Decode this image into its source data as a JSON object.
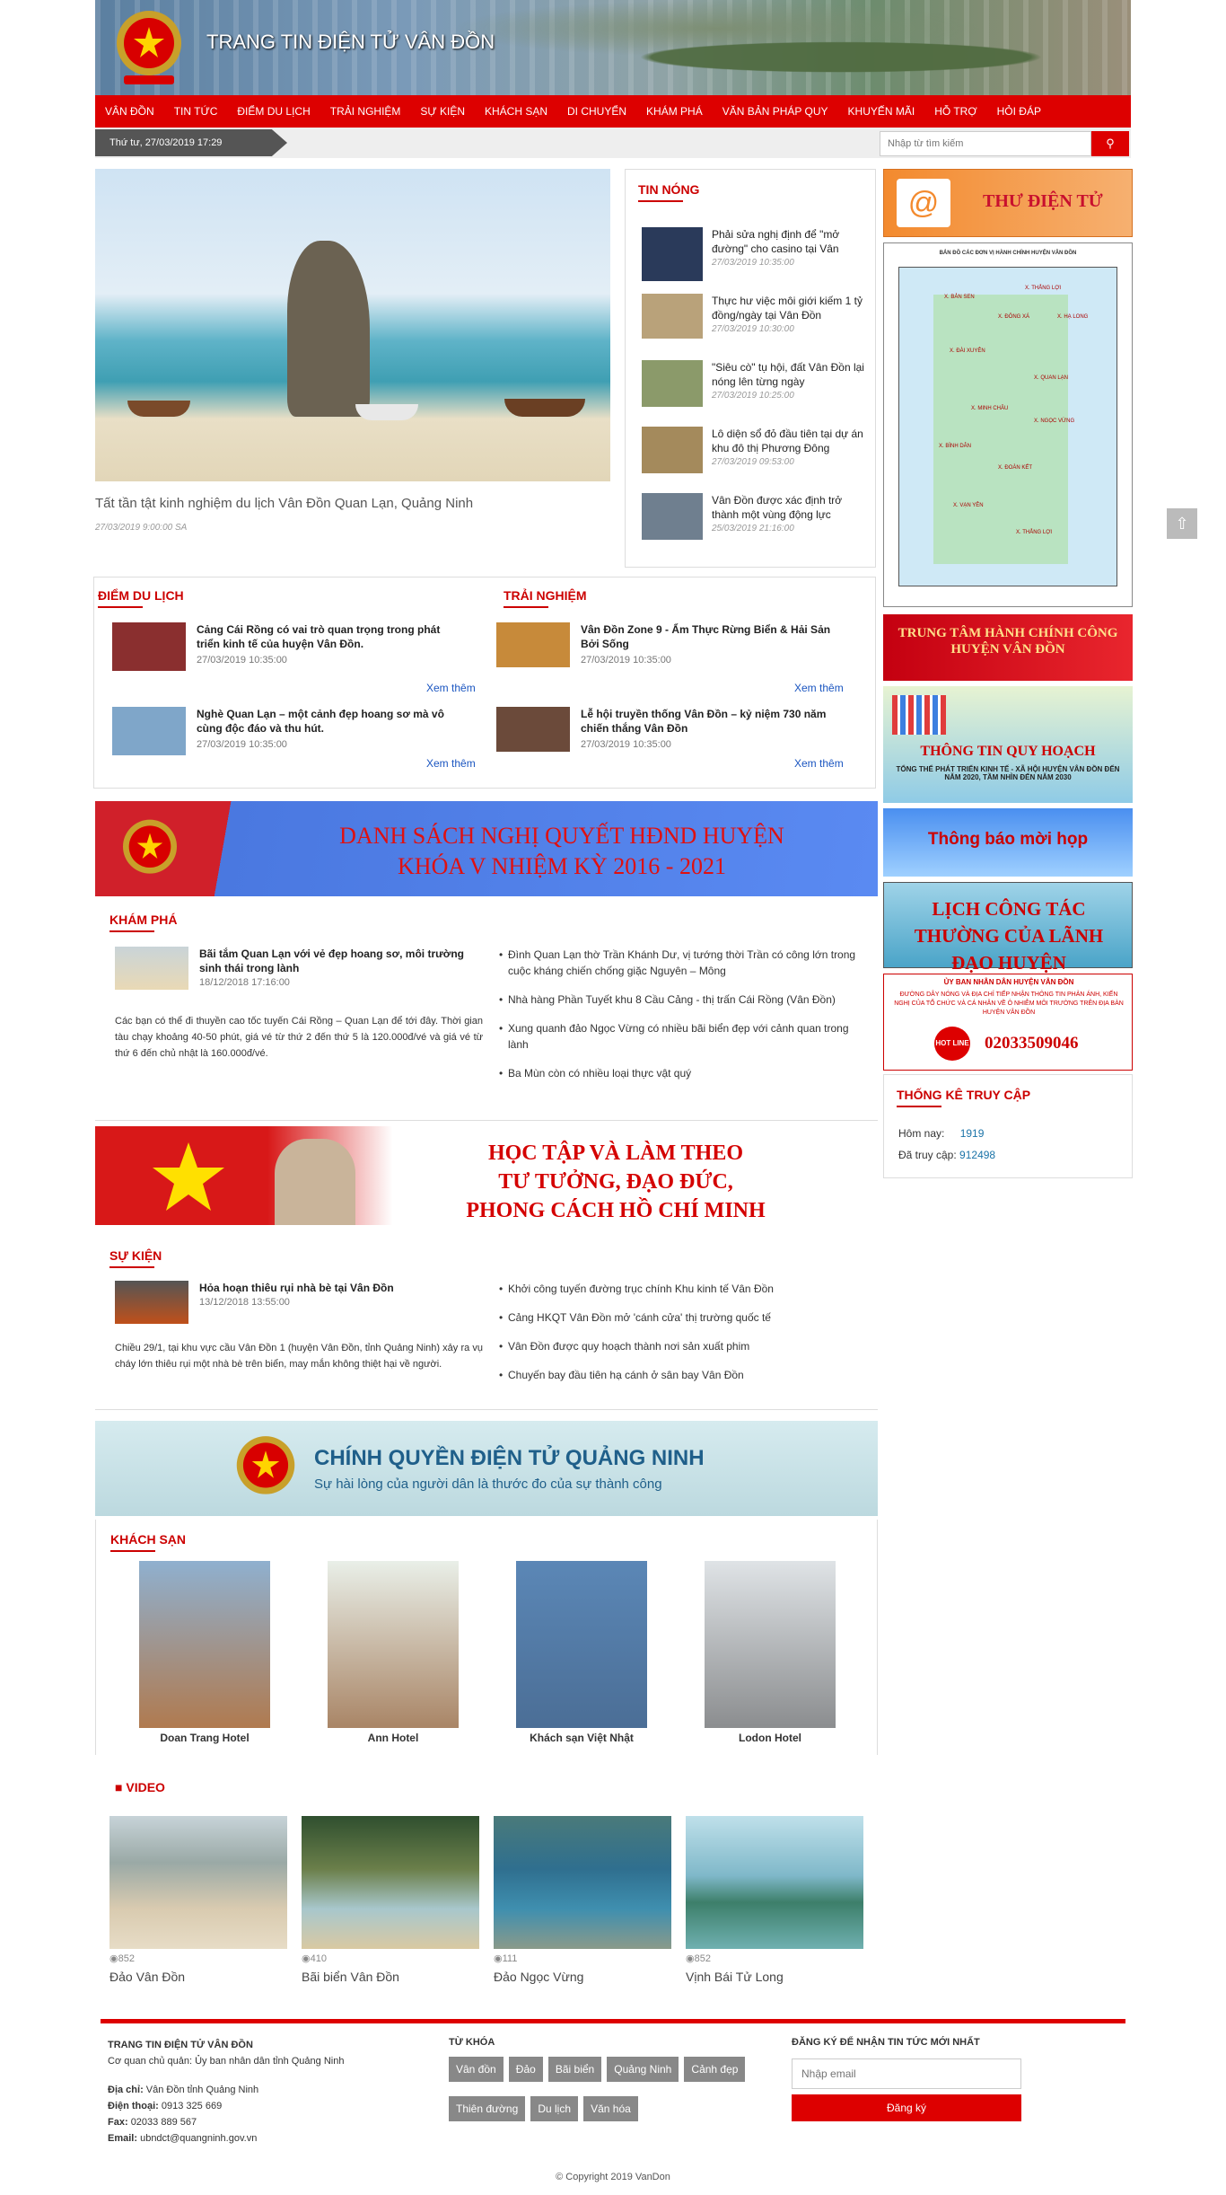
{
  "header": {
    "title": "TRANG TIN ĐIỆN TỬ VÂN ĐỒN"
  },
  "nav": [
    "VÂN ĐỒN",
    "TIN TỨC",
    "ĐIỂM DU LỊCH",
    "TRẢI NGHIỆM",
    "SỰ KIỆN",
    "KHÁCH SẠN",
    "DI CHUYỂN",
    "KHÁM PHÁ",
    "VĂN BẢN PHÁP QUY",
    "KHUYẾN MÃI",
    "HỖ TRỢ",
    "HỎI ĐÁP"
  ],
  "topbar": {
    "date": "Thứ tư, 27/03/2019 17:29",
    "search_placeholder": "Nhập từ tìm kiếm"
  },
  "featured": {
    "title": "Tất tần tật kinh nghiệm du lịch Vân Đồn Quan Lạn, Quảng Ninh",
    "date": "27/03/2019 9:00:00 SA"
  },
  "hot": {
    "title": "TIN NÓNG",
    "items": [
      {
        "title": "Phải sửa nghị định để \"mở đường\" cho casino tại Vân",
        "date": "27/03/2019 10:35:00"
      },
      {
        "title": "Thực hư việc môi giới kiếm 1 tỷ đồng/ngày tại Vân Đồn",
        "date": "27/03/2019 10:30:00"
      },
      {
        "title": "\"Siêu cò\" tụ hội, đất Vân Đồn lại nóng lên từng ngày",
        "date": "27/03/2019 10:25:00"
      },
      {
        "title": "Lô diện sổ đỏ đầu tiên tại dự án khu đô thị Phương Đông",
        "date": "27/03/2019 09:53:00"
      },
      {
        "title": "Vân Đồn được xác định trở thành một vùng động lực",
        "date": "25/03/2019 21:16:00"
      }
    ]
  },
  "dulich": {
    "title": "ĐIỂM DU LỊCH",
    "more": "Xem thêm",
    "items": [
      {
        "title": "Cảng Cái Rồng có vai trò quan trọng trong phát triển kinh tế của huyện Vân Đồn.",
        "date": "27/03/2019 10:35:00"
      },
      {
        "title": "Nghè Quan Lạn – một cảnh đẹp hoang sơ mà vô cùng độc đáo và thu hút.",
        "date": "27/03/2019 10:35:00"
      }
    ]
  },
  "trainghiem": {
    "title": "TRẢI NGHIỆM",
    "more": "Xem thêm",
    "items": [
      {
        "title": "Vân Đồn Zone 9 - Ẩm Thực Rừng Biển & Hải Sản Bởi Sống",
        "date": "27/03/2019 10:35:00"
      },
      {
        "title": "Lễ hội truyền thống Vân Đồn – kỷ niệm 730 năm chiến thắng Vân Đồn",
        "date": "27/03/2019 10:35:00"
      }
    ]
  },
  "banner1": {
    "line1": "DANH SÁCH NGHỊ QUYẾT HĐND HUYỆN",
    "line2": "KHÓA V NHIỆM KỲ 2016 - 2021"
  },
  "khampha": {
    "title": "KHÁM PHÁ",
    "lead_title": "Bãi tắm Quan Lạn với vẻ đẹp hoang sơ, môi trường sinh thái trong lành",
    "lead_date": "18/12/2018 17:16:00",
    "lead_desc": "Các bạn có thể đi thuyền cao tốc tuyến Cái Rồng – Quan Lạn để tới đây. Thời gian tàu chạy khoảng 40-50 phút, giá vé từ thứ 2 đến thứ 5 là 120.000đ/vé và giá vé từ thứ 6 đến chủ nhật là 160.000đ/vé.",
    "list": [
      "Đình Quan Lạn thờ Trần Khánh Dư, vị tướng thời Trần có công lớn trong cuộc kháng chiến chống giặc Nguyên – Mông",
      "Nhà hàng Phần Tuyết khu 8 Cầu Cảng - thị trấn Cái Rồng (Vân Đồn)",
      "Xung quanh đảo Ngọc Vừng có nhiều bãi biển đẹp với cảnh quan trong lành",
      "Ba Mùn còn có nhiều loại thực vật quý"
    ]
  },
  "banner2": {
    "line1": "HỌC TẬP VÀ LÀM THEO",
    "line2": "TƯ TƯỞNG, ĐẠO ĐỨC,",
    "line3": "PHONG CÁCH HỒ CHÍ MINH"
  },
  "sukien": {
    "title": "SỰ KIỆN",
    "lead_title": "Hỏa hoạn thiêu rụi nhà bè tại Vân Đồn",
    "lead_date": "13/12/2018 13:55:00",
    "lead_desc": "Chiều 29/1, tại khu vực cầu Vân Đồn 1 (huyện Vân Đồn, tỉnh Quảng Ninh) xảy ra vụ cháy lớn thiêu rụi một nhà bè trên biển, may mắn không thiệt hại về người.",
    "list": [
      "Khởi công tuyến đường trục chính Khu kinh tế Vân Đồn",
      "Cảng HKQT Vân Đồn mở 'cánh cửa' thị trường quốc tế",
      "Vân Đồn được quy hoạch thành nơi sản xuất phim",
      "Chuyến bay đầu tiên hạ cánh ở sân bay Vân Đồn"
    ]
  },
  "banner3": {
    "line1": "CHÍNH QUYỀN ĐIỆN TỬ QUẢNG NINH",
    "line2": "Sự hài lòng của người dân là thước đo của sự thành công"
  },
  "hotel": {
    "title": "KHÁCH SẠN",
    "items": [
      "Doan Trang Hotel",
      "Ann Hotel",
      "Khách sạn Việt Nhật",
      "Lodon Hotel"
    ]
  },
  "video": {
    "title": "VIDEO",
    "items": [
      {
        "views": "852",
        "name": "Đảo Vân Đồn"
      },
      {
        "views": "410",
        "name": "Bãi biển Vân Đồn"
      },
      {
        "views": "111",
        "name": "Đảo Ngọc Vừng"
      },
      {
        "views": "852",
        "name": "Vịnh Bái Tử Long"
      }
    ]
  },
  "side": {
    "mail": "THƯ ĐIỆN TỬ",
    "map_title": "BẢN ĐỒ CÁC ĐƠN VỊ HÀNH CHÍNH HUYỆN VÂN ĐỒN",
    "map_labels": [
      "X. BẢN SEN",
      "X. THẮNG LỢI",
      "X. ĐÔNG XÁ",
      "X. HẠ LONG",
      "X. ĐÀI XUYÊN",
      "X. QUAN LẠN",
      "X. MINH CHÂU",
      "X. NGỌC VỪNG",
      "X. BÌNH DÂN",
      "X. ĐOÀN KẾT",
      "X. VẠN YÊN",
      "X. THẮNG LỢI"
    ],
    "hcc": "TRUNG TÂM HÀNH CHÍNH CÔNG HUYỆN VÂN ĐỒN",
    "quyhoach": "THÔNG TIN QUY HOẠCH",
    "quyhoach_sub": "TỔNG THỂ PHÁT TRIỂN KINH TẾ - XÃ HỘI HUYỆN VÂN ĐỒN ĐẾN NĂM 2020, TẦM NHÌN ĐẾN NĂM 2030",
    "hop": "Thông báo mời họp",
    "lich": "LỊCH CÔNG TÁC THƯỜNG CỦA LÃNH ĐẠO HUYỆN",
    "hotline_head": "ỦY BAN NHÂN DÂN HUYỆN VÂN ĐỒN",
    "hotline_text": "ĐƯỜNG DÂY NÓNG VÀ ĐỊA CHỈ TIẾP NHẬN THÔNG TIN PHẢN ÁNH, KIẾN NGHỊ CỦA TỔ CHỨC VÀ CÁ NHÂN VỀ Ô NHIỄM MÔI TRƯỜNG TRÊN ĐỊA BÀN HUYỆN VÂN ĐỒN",
    "hotline_badge": "HOT LINE",
    "hotline_num": "02033509046",
    "stats_title": "THỐNG KÊ TRUY CẬP",
    "today_label": "Hôm nay:",
    "today": "1919",
    "total_label": "Đã truy cập:",
    "total": "912498"
  },
  "footer": {
    "title": "TRANG TIN ĐIỆN TỬ VÂN ĐỒN",
    "owner": "Cơ quan chủ quản: Ủy ban nhân dân tỉnh Quảng Ninh",
    "addr_l": "Địa chỉ:",
    "addr": "Vân Đồn tỉnh Quảng Ninh",
    "phone_l": "Điện thoại:",
    "phone": "0913 325 669",
    "fax_l": "Fax:",
    "fax": "02033 889 567",
    "email_l": "Email:",
    "email": "ubndct@quangninh.gov.vn",
    "kw_title": "TỪ KHÓA",
    "keywords": [
      "Vân đồn",
      "Đảo",
      "Bãi biển",
      "Quảng Ninh",
      "Cảnh đẹp",
      "Thiên đường",
      "Du lịch",
      "Văn hóa"
    ],
    "sub_title": "ĐĂNG KÝ ĐỂ NHẬN TIN TỨC MỚI NHẤT",
    "email_ph": "Nhập email",
    "sub_btn": "Đăng ký",
    "copyright": "© Copyright 2019 VanDon"
  },
  "colors": {
    "primary": "#dd0000",
    "nav": "#dd0000"
  }
}
